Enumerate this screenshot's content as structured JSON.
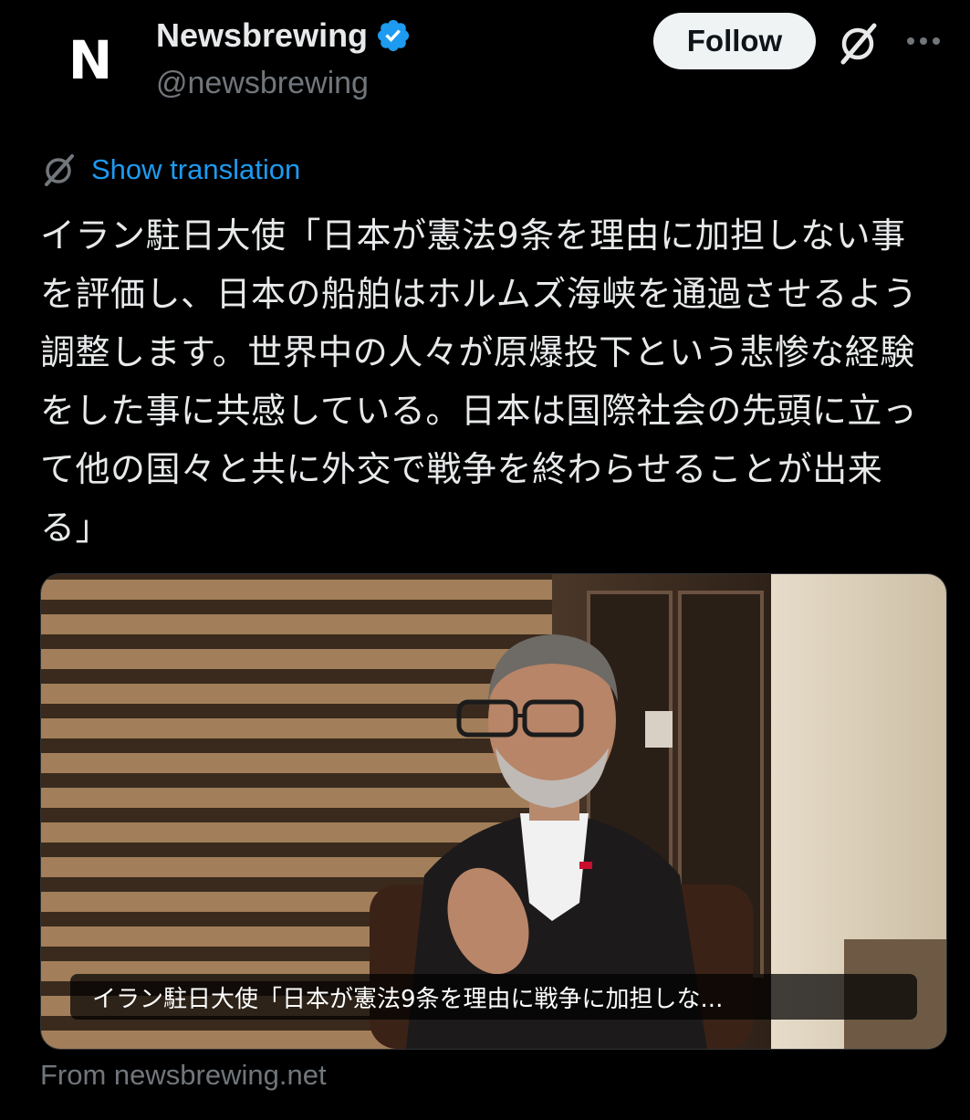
{
  "author": {
    "avatar_letter": "N",
    "display_name": "Newsbrewing",
    "handle": "@newsbrewing",
    "verified_color": "#1d9bf0"
  },
  "actions": {
    "follow_label": "Follow",
    "grok_icon": "grok-icon",
    "more_icon": "more-icon"
  },
  "translation": {
    "link_label": "Show translation",
    "icon": "translate-icon"
  },
  "post": {
    "text": "イラン駐日大使「日本が憲法9条を理由に加担しない事を評価し、日本の船舶はホルムズ海峡を通過させるよう調整します。世界中の人々が原爆投下という悲惨な経験をした事に共感している。日本は国際社会の先頭に立って他の国々と共に外交で戦争を終わらせることが出来る」"
  },
  "media": {
    "caption": "イラン駐日大使「日本が憲法9条を理由に戦争に加担しな..."
  },
  "link_card": {
    "source": "From newsbrewing.net"
  },
  "colors": {
    "background": "#000000",
    "text": "#e7e9ea",
    "secondary": "#71767b",
    "link": "#1d9bf0"
  }
}
